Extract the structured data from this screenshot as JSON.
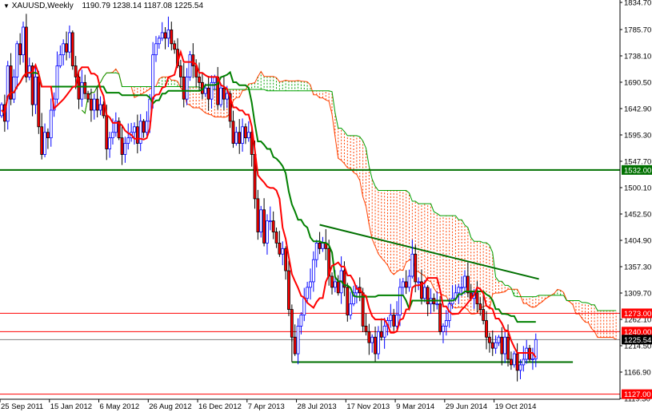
{
  "header": {
    "symbol": "XAUUSD,Weekly",
    "open": "1190.79",
    "high": "1238.14",
    "low": "1187.08",
    "close": "1225.54",
    "menu_icon": "triangle-down-icon"
  },
  "colors": {
    "up": "#0000ff",
    "down": "#ff0000",
    "tenkan": "#ff0000",
    "kijun": "#008000",
    "cloud_bull": "#00a000",
    "cloud_bear": "#ff4000",
    "hline_red": "#ff0000",
    "hline_green": "#007000",
    "current": "#808080"
  },
  "chart_data": {
    "type": "candlestick",
    "title": "XAUUSD,Weekly",
    "ylim": [
      1119.3,
      1834.7
    ],
    "y_ticks": [
      "1834.70",
      "1785.70",
      "1738.10",
      "1690.50",
      "1642.90",
      "1595.30",
      "1547.70",
      "1500.10",
      "1452.50",
      "1404.90",
      "1357.30",
      "1309.70",
      "1262.10",
      "1214.50",
      "1166.90",
      "1119.30"
    ],
    "x_labels": [
      "25 Sep 2011",
      "15 Jan 2012",
      "6 May 2012",
      "26 Aug 2012",
      "16 Dec 2012",
      "7 Apr 2013",
      "28 Jul 2013",
      "17 Nov 2013",
      "9 Mar 2014",
      "29 Jun 2014",
      "19 Oct 2014"
    ],
    "x_label_interval_weeks": 16,
    "weekly_close": [
      1650,
      1620,
      1720,
      1660,
      1700,
      1760,
      1740,
      1790,
      1700,
      1720,
      1650,
      1700,
      1610,
      1560,
      1600,
      1590,
      1640,
      1660,
      1720,
      1740,
      1760,
      1745,
      1780,
      1720,
      1700,
      1660,
      1690,
      1670,
      1660,
      1640,
      1660,
      1640,
      1650,
      1630,
      1570,
      1590,
      1600,
      1620,
      1590,
      1560,
      1580,
      1590,
      1600,
      1610,
      1580,
      1620,
      1600,
      1620,
      1660,
      1740,
      1760,
      1770,
      1780,
      1770,
      1785,
      1760,
      1750,
      1720,
      1700,
      1660,
      1700,
      1740,
      1720,
      1700,
      1690,
      1670,
      1680,
      1660,
      1690,
      1700,
      1650,
      1680,
      1660,
      1670,
      1620,
      1580,
      1600,
      1580,
      1610,
      1590,
      1600,
      1560,
      1480,
      1420,
      1460,
      1400,
      1440,
      1440,
      1420,
      1400,
      1380,
      1390,
      1350,
      1280,
      1230,
      1200,
      1250,
      1270,
      1300,
      1320,
      1330,
      1370,
      1400,
      1390,
      1400,
      1390,
      1340,
      1320,
      1330,
      1310,
      1350,
      1320,
      1270,
      1290,
      1310,
      1320,
      1310,
      1250,
      1240,
      1220,
      1230,
      1200,
      1240,
      1230,
      1250,
      1260,
      1270,
      1250,
      1270,
      1320,
      1330,
      1320,
      1340,
      1380,
      1330,
      1330,
      1300,
      1320,
      1290,
      1300,
      1290,
      1290,
      1240,
      1250,
      1260,
      1290,
      1300,
      1310,
      1320,
      1320,
      1340,
      1310,
      1300,
      1310,
      1290,
      1280,
      1260,
      1230,
      1220,
      1210,
      1220,
      1230,
      1200,
      1230,
      1190,
      1180,
      1200,
      1170,
      1180,
      1190,
      1210,
      1190,
      1190.79,
      1225.54
    ],
    "indicators": {
      "ichimoku": {
        "tenkan": 9,
        "kijun": 26,
        "senkou_b": 52
      }
    },
    "hlines": [
      {
        "price": 1532.0,
        "label": "1532.00",
        "color": "#007000"
      },
      {
        "price": 1273.0,
        "label": "1273.00",
        "color": "#ff0000"
      },
      {
        "price": 1240.0,
        "label": "1240.00",
        "color": "#ff0000"
      },
      {
        "price": 1225.54,
        "label": "1225.54",
        "color": "#808080"
      },
      {
        "price": 1127.0,
        "label": "1127.00",
        "color": "#ff0000"
      }
    ],
    "support_line": {
      "price": 1185,
      "from_week": 94,
      "to_week": 185
    },
    "trendline": {
      "from": {
        "week": 103,
        "price": 1433
      },
      "to": {
        "week": 174,
        "price": 1335
      }
    }
  }
}
